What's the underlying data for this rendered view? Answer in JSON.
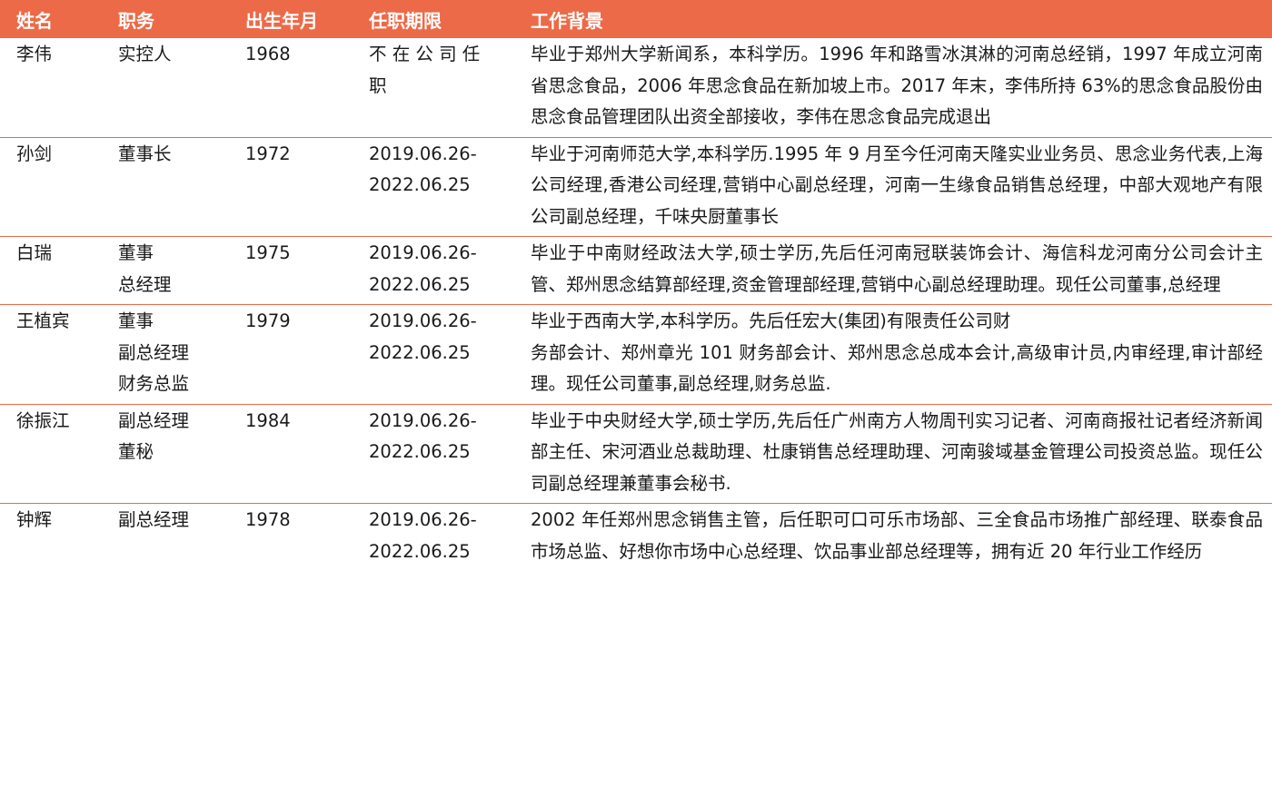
{
  "columns": {
    "name": "姓名",
    "title": "职务",
    "birth": "出生年月",
    "term": "任职期限",
    "background": "工作背景"
  },
  "rows": [
    {
      "name": "李伟",
      "title": "实控人",
      "birth": "1968",
      "term": "不 在 公 司 任\n职",
      "background": "毕业于郑州大学新闻系，本科学历。1996 年和路雪冰淇淋的河南总经销，1997 年成立河南省思念食品，2006 年思念食品在新加坡上市。2017 年末，李伟所持 63%的思念食品股份由思念食品管理团队出资全部接收，李伟在思念食品完成退出"
    },
    {
      "name": "孙剑",
      "title": "董事长",
      "birth": "1972",
      "term": "2019.06.26-\n2022.06.25",
      "background": "毕业于河南师范大学,本科学历.1995 年 9 月至今任河南天隆实业业务员、思念业务代表,上海公司经理,香港公司经理,营销中心副总经理，河南一生缘食品销售总经理，中部大观地产有限公司副总经理，千味央厨董事长"
    },
    {
      "name": "白瑞",
      "title": "董事\n总经理",
      "birth": "1975",
      "term": "2019.06.26-\n2022.06.25",
      "background": "毕业于中南财经政法大学,硕士学历,先后任河南冠联装饰会计、海信科龙河南分公司会计主管、郑州思念结算部经理,资金管理部经理,营销中心副总经理助理。现任公司董事,总经理"
    },
    {
      "name": "王植宾",
      "title": "董事\n副总经理\n财务总监",
      "birth": "1979",
      "term": "2019.06.26-\n2022.06.25",
      "background": "毕业于西南大学,本科学历。先后任宏大(集团)有限责任公司财\n务部会计、郑州章光 101 财务部会计、郑州思念总成本会计,高级审计员,内审经理,审计部经理。现任公司董事,副总经理,财务总监."
    },
    {
      "name": "徐振江",
      "title": "副总经理\n董秘",
      "birth": "1984",
      "term": "2019.06.26-\n2022.06.25",
      "background": "毕业于中央财经大学,硕士学历,先后任广州南方人物周刊实习记者、河南商报社记者经济新闻部主任、宋河酒业总裁助理、杜康销售总经理助理、河南骏域基金管理公司投资总监。现任公司副总经理兼董事会秘书."
    },
    {
      "name": "钟辉",
      "title": "副总经理",
      "birth": "1978",
      "term": "2019.06.26-\n2022.06.25",
      "background": "2002 年任郑州思念销售主管，后任职可口可乐市场部、三全食品市场推广部经理、联泰食品市场总监、好想你市场中心总经理、饮品事业部总经理等，拥有近 20 年行业工作经历"
    }
  ]
}
